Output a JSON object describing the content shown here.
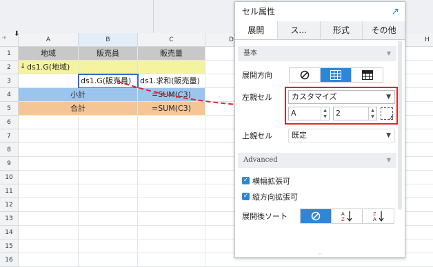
{
  "sheet": {
    "columns": [
      "A",
      "B",
      "C",
      "D",
      "H"
    ],
    "rows": [
      "1",
      "2",
      "3",
      "4",
      "5",
      "6",
      "7",
      "8",
      "9",
      "10",
      "11",
      "12",
      "13",
      "14",
      "15",
      "16"
    ],
    "cells": {
      "a1": "地域",
      "b1": "販売員",
      "c1": "販売量",
      "a2": "ds1.G(地域)",
      "b3": "ds1.G(販売員)",
      "c3": "ds1.求和(販売量)",
      "ab4": "小計",
      "c4": "=SUM(C3)",
      "ab5": "合計",
      "c5": "=SUM(C3)"
    },
    "row_expand_mark": "↓",
    "corner_arrow": "⬇"
  },
  "panel": {
    "title": "セル属性",
    "tabs": [
      {
        "label": "展開",
        "active": true
      },
      {
        "label": "ス...",
        "active": false
      },
      {
        "label": "形式",
        "active": false
      },
      {
        "label": "その他",
        "active": false
      }
    ],
    "basic_section": "基本",
    "expand_direction_label": "展開方向",
    "left_parent_label": "左親セル",
    "left_parent_value": "カスタマイズ",
    "left_parent_column": "A",
    "left_parent_row": "2",
    "upper_parent_label": "上親セル",
    "upper_parent_value": "既定",
    "advanced_section": "Advanced",
    "horizontal_extend_label": "横幅拡張可",
    "horizontal_extend_checked": true,
    "vertical_extend_label": "縦方向拡張可",
    "vertical_extend_checked": true,
    "sort_label": "展開後ソート",
    "grip": "⋯"
  },
  "colors": {
    "accent": "#2f86d6",
    "highlight": "#e0242a",
    "header_gray": "#c8c8c8",
    "group_yellow": "#f6f3a0",
    "subtotal_blue": "#9cc5ee",
    "total_orange": "#f5c596"
  }
}
